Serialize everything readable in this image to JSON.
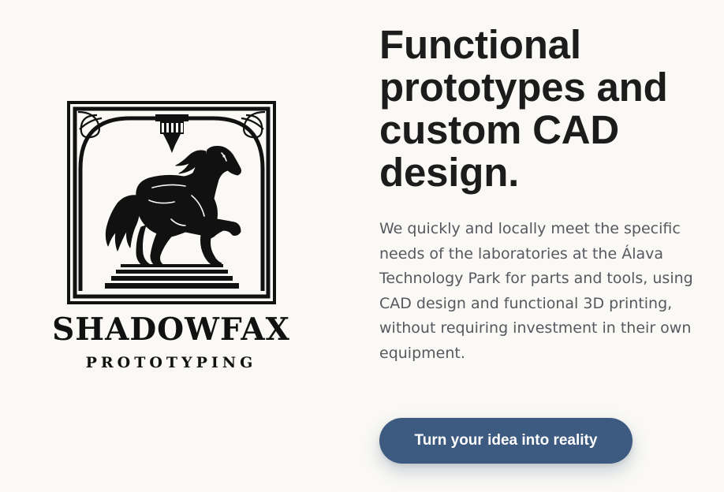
{
  "brand": {
    "name": "SHADOWFAX",
    "tagline": "PROTOTYPING",
    "logo_icon": "horse-3d-printer-logo-icon"
  },
  "hero": {
    "headline": "Functional prototypes and custom CAD design.",
    "description": "We quickly and locally meet the specific needs of the laboratories at the Álava Technology Park for parts and tools, using CAD design and functional 3D printing, without requiring investment in their own equipment.",
    "cta_label": "Turn your idea into reality"
  },
  "colors": {
    "background": "#faf9f5",
    "headline": "#1c1c1c",
    "body_text": "#55595f",
    "cta_background": "#3d5a80",
    "cta_text": "#ffffff",
    "logo": "#111111"
  }
}
